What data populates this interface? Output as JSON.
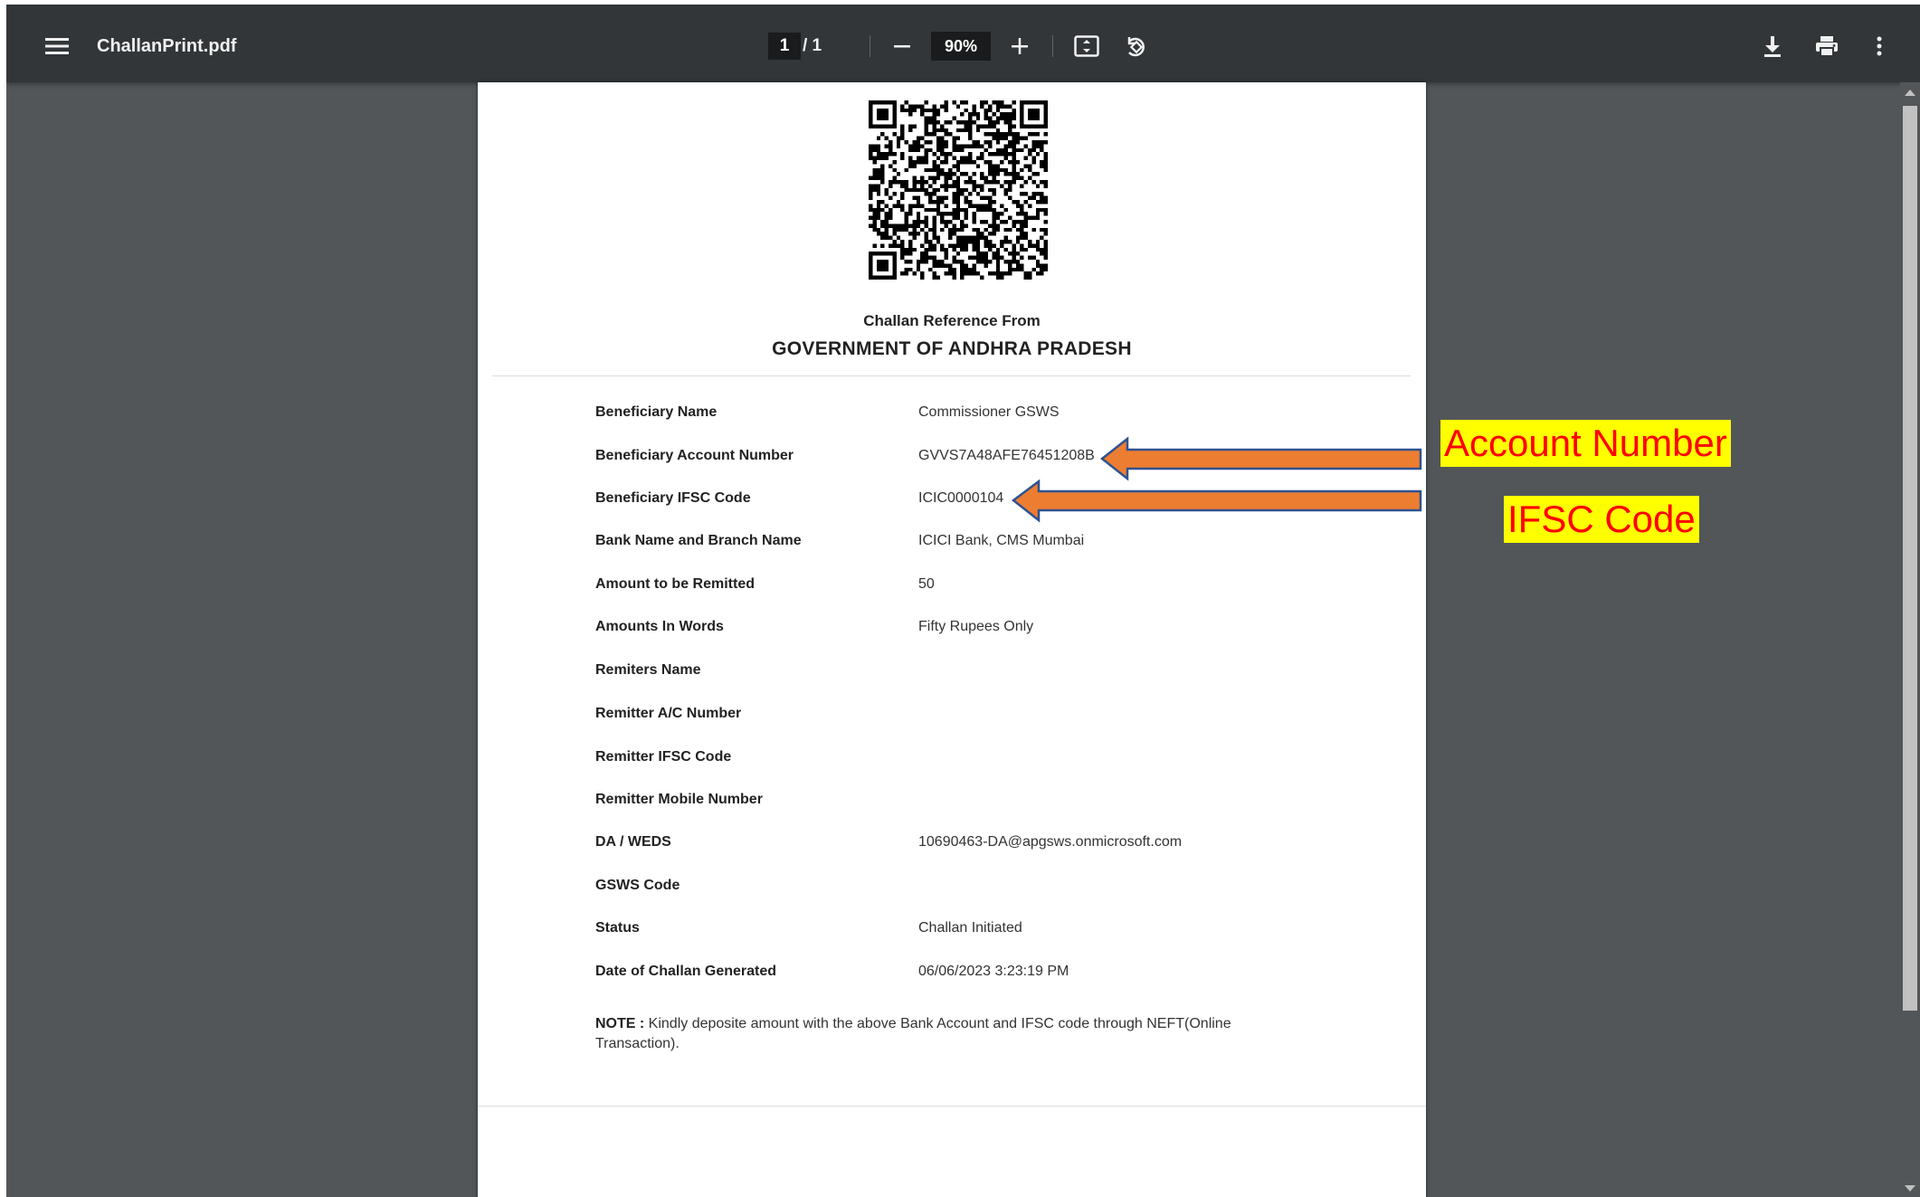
{
  "toolbar": {
    "file_name": "ChallanPrint.pdf",
    "current_page": "1",
    "page_separator": "/ 1",
    "zoom": "90%"
  },
  "icons": {
    "menu": "hamburger-menu-icon",
    "zoom_out": "minus-icon",
    "zoom_in": "plus-icon",
    "fit": "fit-to-page-icon",
    "rotate": "rotate-counterclockwise-icon",
    "download": "download-icon",
    "print": "print-icon",
    "more": "more-vertical-icon"
  },
  "document": {
    "caption": "Challan Reference From",
    "heading": "GOVERNMENT OF ANDHRA PRADESH",
    "rows": [
      {
        "label": "Beneficiary Name",
        "value": "Commissioner GSWS"
      },
      {
        "label": "Beneficiary Account Number",
        "value": "GVVS7A48AFE76451208B"
      },
      {
        "label": "Beneficiary IFSC Code",
        "value": "ICIC0000104"
      },
      {
        "label": "Bank Name and Branch Name",
        "value": "ICICI Bank, CMS Mumbai"
      },
      {
        "label": "Amount to be Remitted",
        "value": "50"
      },
      {
        "label": "Amounts In Words",
        "value": "Fifty Rupees Only"
      },
      {
        "label": "Remiters Name",
        "value": ""
      },
      {
        "label": "Remitter A/C Number",
        "value": ""
      },
      {
        "label": "Remitter IFSC Code",
        "value": ""
      },
      {
        "label": "Remitter Mobile Number",
        "value": ""
      },
      {
        "label": "DA / WEDS",
        "value": "10690463-DA@apgsws.onmicrosoft.com"
      },
      {
        "label": "GSWS Code",
        "value": ""
      },
      {
        "label": "Status",
        "value": "Challan Initiated"
      },
      {
        "label": "Date of Challan Generated",
        "value": "06/06/2023 3:23:19 PM"
      }
    ],
    "note_label": "NOTE :",
    "note_text": "Kindly deposite amount with the above Bank Account and IFSC code through NEFT(Online Transaction)."
  },
  "annotations": {
    "account_label": "Account Number",
    "ifsc_label": "IFSC Code",
    "label_bg": "#ffff00",
    "label_color": "#ff0000",
    "arrow_color": "#ed7d31",
    "arrow_outline": "#2f528f"
  },
  "colors": {
    "toolbar_bg": "#323639",
    "viewer_bg": "#525659",
    "page_bg": "#ffffff"
  }
}
